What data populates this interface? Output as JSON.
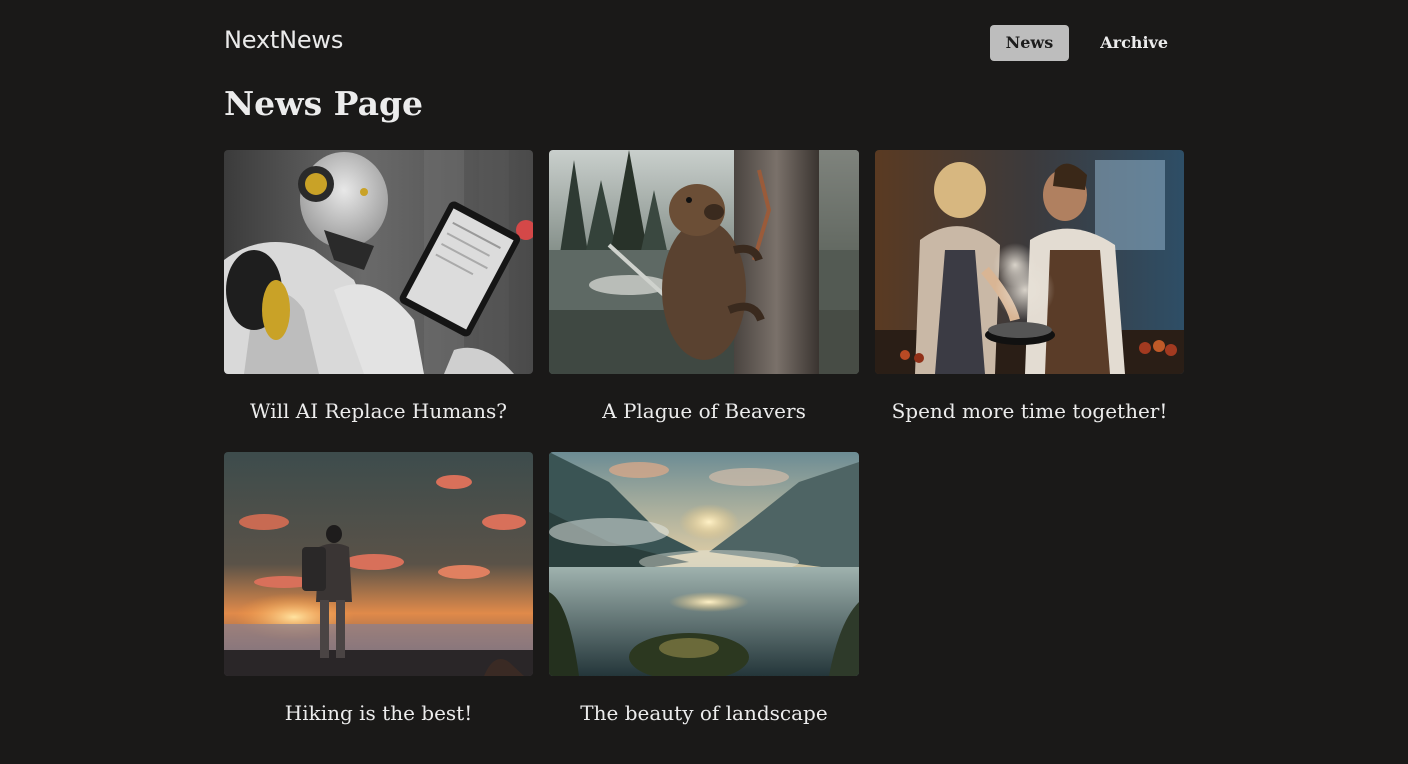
{
  "header": {
    "logo": "NextNews",
    "nav": [
      {
        "label": "News",
        "active": true
      },
      {
        "label": "Archive",
        "active": false
      }
    ]
  },
  "page_title": "News Page",
  "articles": [
    {
      "title": "Will AI Replace Humans?",
      "image": "robot-with-tablet"
    },
    {
      "title": "A Plague of Beavers",
      "image": "beaver-on-tree"
    },
    {
      "title": "Spend more time together!",
      "image": "couple-cooking"
    },
    {
      "title": "Hiking is the best!",
      "image": "hiker-at-sunset"
    },
    {
      "title": "The beauty of landscape",
      "image": "mountain-lake"
    }
  ],
  "colors": {
    "background": "#1a1918",
    "text": "#ececec",
    "active_nav_bg": "#bdbdbd"
  }
}
